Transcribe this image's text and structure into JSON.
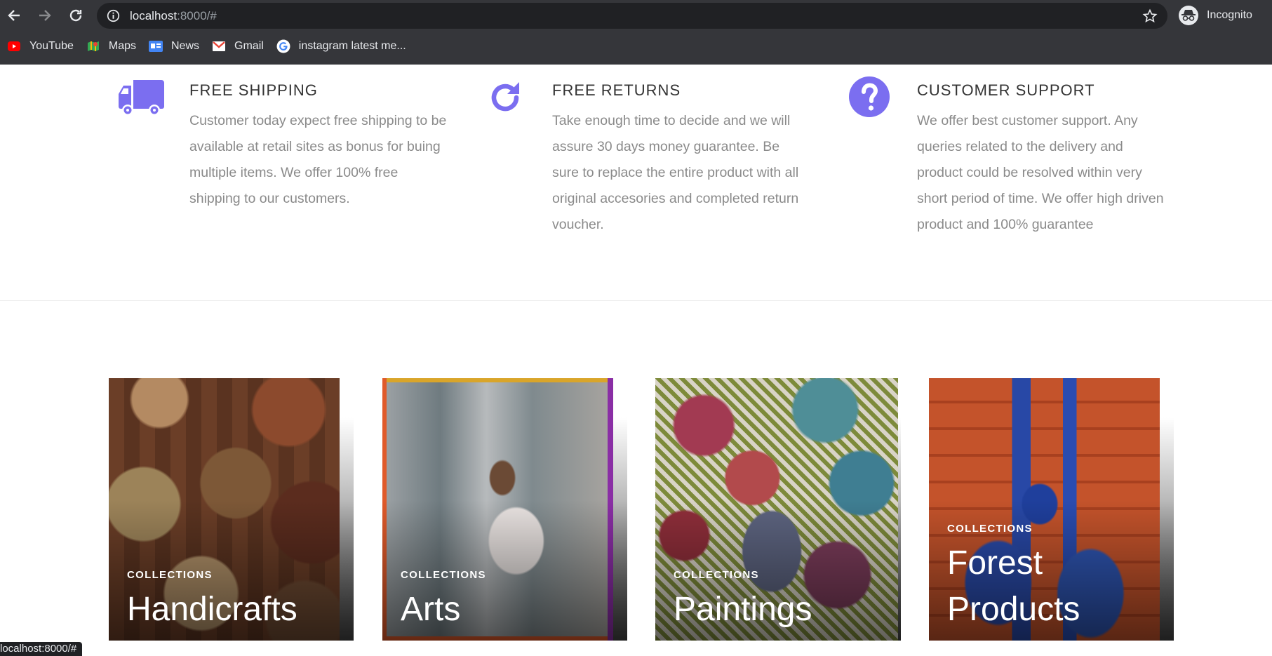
{
  "browser": {
    "url_host": "localhost",
    "url_rest": ":8000/#",
    "profile_label": "Incognito",
    "bookmarks": [
      {
        "label": "YouTube",
        "icon": "youtube-icon"
      },
      {
        "label": "Maps",
        "icon": "maps-icon"
      },
      {
        "label": "News",
        "icon": "news-icon"
      },
      {
        "label": "Gmail",
        "icon": "gmail-icon"
      },
      {
        "label": "instagram latest me...",
        "icon": "google-icon"
      }
    ],
    "status_url": "localhost:8000/#"
  },
  "colors": {
    "accent": "#7b6ef0",
    "chrome_bg": "#35363a",
    "omnibox_bg": "#202124"
  },
  "features": [
    {
      "icon": "truck-icon",
      "title": "FREE SHIPPING",
      "description": "Customer today expect free shipping to be available at retail sites as bonus for buing multiple items. We offer 100% free shipping to our customers."
    },
    {
      "icon": "refresh-icon",
      "title": "FREE RETURNS",
      "description": "Take enough time to decide and we will assure 30 days money guarantee. Be sure to replace the entire product with all original accesories and completed return voucher."
    },
    {
      "icon": "question-icon",
      "title": "CUSTOMER SUPPORT",
      "description": "We offer best customer support. Any queries related to the delivery and product could be resolved within very short period of time. We offer high driven product and 100% guarantee"
    }
  ],
  "collections": [
    {
      "kicker": "COLLECTIONS",
      "title": "Handicrafts"
    },
    {
      "kicker": "COLLECTIONS",
      "title": "Arts"
    },
    {
      "kicker": "COLLECTIONS",
      "title": "Paintings"
    },
    {
      "kicker": "COLLECTIONS",
      "title_line1": "Forest",
      "title_line2": "Products"
    }
  ]
}
